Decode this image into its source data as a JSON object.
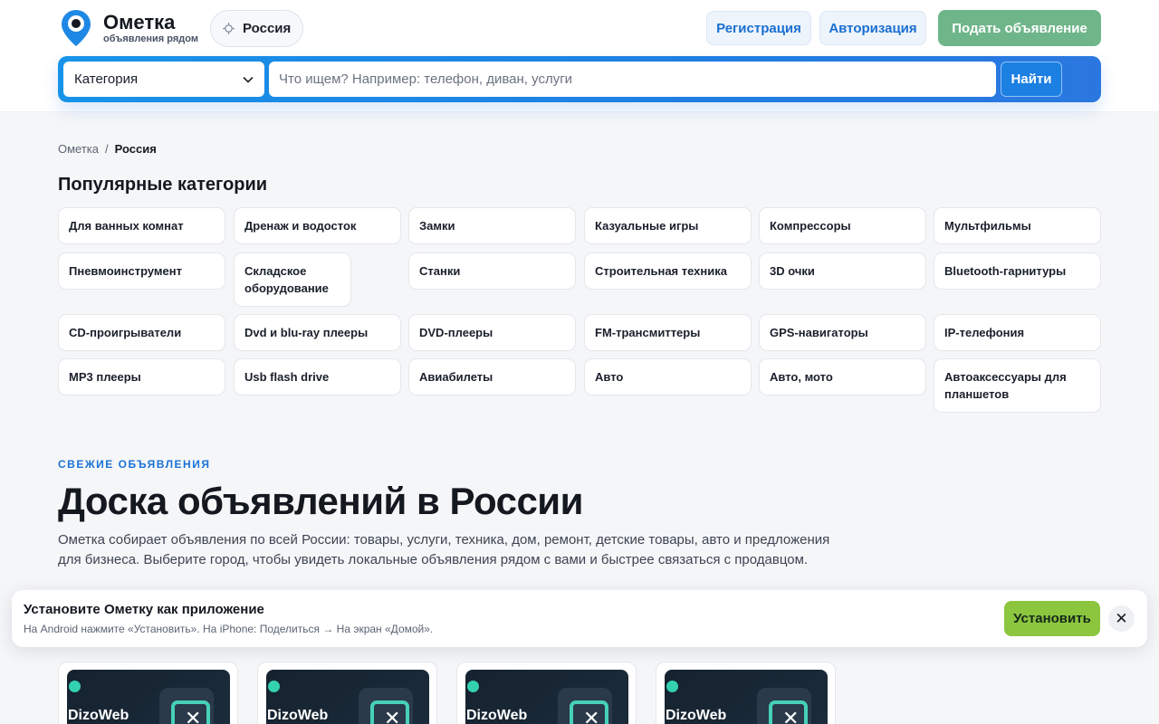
{
  "brand": {
    "title": "Ометка",
    "subtitle": "объявления рядом",
    "pin_color": "#1e88e5"
  },
  "region": {
    "label": "Россия",
    "icon": "crosshair-icon"
  },
  "nav": {
    "register": "Регистрация",
    "login": "Авторизация",
    "post_ad": "Подать объявление"
  },
  "search": {
    "category_label": "Категория",
    "placeholder": "Что ищем? Например: телефон, диван, услуги",
    "value": "",
    "submit": "Найти"
  },
  "breadcrumb": {
    "home": "Ометка",
    "separator": "/",
    "current": "Россия"
  },
  "popular": {
    "title": "Популярные категории",
    "items": [
      "Для ванных комнат",
      "Дренаж и водосток",
      "Замки",
      "Казуальные игры",
      "Компрессоры",
      "Мультфильмы",
      "Пневмоинструмент",
      "Складское оборудование",
      "Станки",
      "Строительная техника",
      "3D очки",
      "Bluetooth-гарнитуры",
      "CD-проигрыватели",
      "Dvd и blu-ray плееры",
      "DVD-плееры",
      "FM-трансмиттеры",
      "GPS-навигаторы",
      "IP-телефония",
      "MP3 плееры",
      "Usb flash drive",
      "Авиабилеты",
      "Авто",
      "Авто, мото",
      "Автоаксессуары для планшетов"
    ]
  },
  "hero": {
    "eyebrow": "СВЕЖИЕ ОБЪЯВЛЕНИЯ",
    "title": "Доска объявлений в России",
    "lead": "Ометка собирает объявления по всей России: товары, услуги, техника, дом, ремонт, детские товары, авто и предложения для бизнеса. Выберите город, чтобы увидеть локальные объявления рядом с вами и быстрее связаться с продавцом."
  },
  "install_banner": {
    "title": "Установите Ометку как приложение",
    "subtitle": "На Android нажмите «Установить». На iPhone: Поделиться → На экран «Домой».",
    "button": "Установить",
    "close": "✕"
  },
  "cards": [
    {
      "brand": "DizoWeb"
    },
    {
      "brand": "DizoWeb"
    },
    {
      "brand": "DizoWeb"
    },
    {
      "brand": "DizoWeb"
    }
  ]
}
